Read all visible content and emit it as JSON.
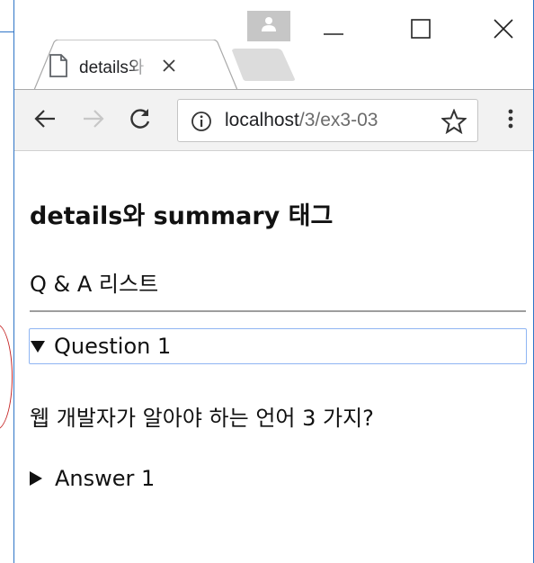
{
  "browser": {
    "tab": {
      "title": "details와 summary 태그"
    },
    "address_bar": {
      "host": "localhost",
      "path": "/3/ex3-03"
    }
  },
  "page": {
    "heading": "details와 summary 태그",
    "subheading": "Q & A 리스트",
    "details": [
      {
        "summary": "Question 1",
        "open": true,
        "content": "웹 개발자가 알아야 하는 언어 3 가지?"
      },
      {
        "summary": "Answer 1",
        "open": false
      }
    ]
  },
  "colors": {
    "accent_focus": "#8fb5f3",
    "window_border": "#2f75c7",
    "toolbar_bg": "#f2f2f2"
  }
}
